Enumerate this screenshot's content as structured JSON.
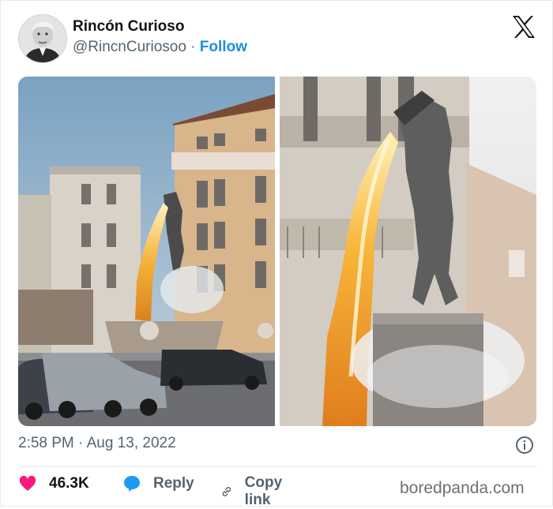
{
  "header": {
    "display_name": "Rincón Curioso",
    "handle": "@RincnCuriosoo",
    "separator": "·",
    "follow_label": "Follow",
    "logo_icon": "x-logo-icon"
  },
  "media": {
    "photos": [
      {
        "name": "fountain-photo-wide",
        "description_icon": "photo"
      },
      {
        "name": "fountain-photo-closeup",
        "description_icon": "photo"
      }
    ]
  },
  "meta": {
    "timestamp": "2:58 PM · Aug 13, 2022",
    "info_icon": "info-icon"
  },
  "actions": {
    "likes_count": "46.3K",
    "reply_label": "Reply",
    "copy_link_label": "Copy link"
  },
  "watermark": "boredpanda.com",
  "colors": {
    "follow_blue": "#1d8fe0",
    "like_pink": "#f91880",
    "muted_gray": "#536471"
  }
}
